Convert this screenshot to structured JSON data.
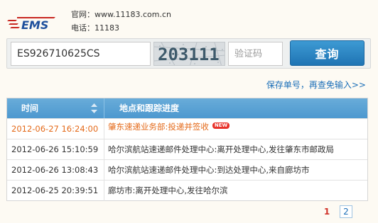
{
  "header": {
    "logo_text": "EMS",
    "website_label": "官网：",
    "website": "www.11183.com.cn",
    "phone_label": "电话：",
    "phone": "11183"
  },
  "search": {
    "tracking_value": "ES926710625CS",
    "captcha_digits": "203111",
    "captcha_placeholder": "验证码",
    "query_label": "查询"
  },
  "save_link": "保存单号，再查免输入>>",
  "table": {
    "columns": [
      "时间",
      "地点和跟踪进度"
    ],
    "rows": [
      {
        "time": "2012-06-27 16:24:00",
        "desc": "肇东速递业务部:投递并签收",
        "badge": "NEW"
      },
      {
        "time": "2012-06-26 15:10:59",
        "desc": "哈尔滨航站速递邮件处理中心:离开处理中心,发往肇东市邮政局"
      },
      {
        "time": "2012-06-26 13:08:43",
        "desc": "哈尔滨航站速递邮件处理中心:到达处理中心,来自廊坊市"
      },
      {
        "time": "2012-06-25 20:39:51",
        "desc": "廊坊市:离开处理中心,发往哈尔滨"
      }
    ]
  },
  "pagination": {
    "current": "1",
    "next": "2"
  },
  "colors": {
    "accent": "#1f74b4",
    "latest": "#e46a1a",
    "header_bg": "#5aa1d4"
  }
}
